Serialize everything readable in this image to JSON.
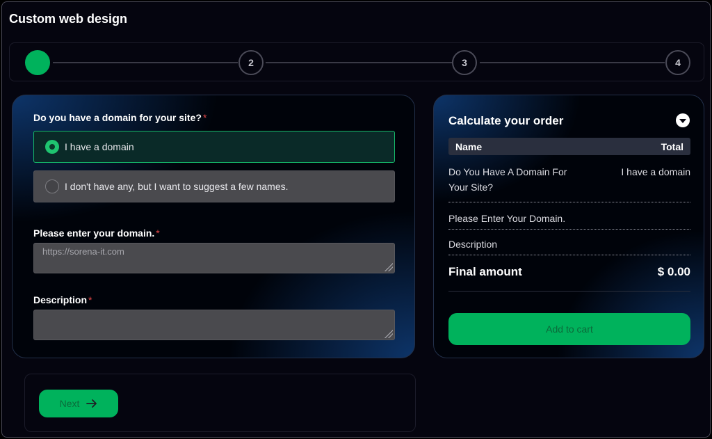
{
  "page": {
    "title": "Custom web design"
  },
  "stepper": {
    "steps": [
      {
        "label": "",
        "active": true
      },
      {
        "label": "2",
        "active": false
      },
      {
        "label": "3",
        "active": false
      },
      {
        "label": "4",
        "active": false
      }
    ]
  },
  "form": {
    "domain_question": "Do you have a domain for your site?",
    "required_mark": "*",
    "options": [
      {
        "label": "I have a domain",
        "selected": true
      },
      {
        "label": "I don't have any, but I want to suggest a few names.",
        "selected": false
      }
    ],
    "domain_label": "Please enter your domain.",
    "domain_placeholder": "https://sorena-it.com",
    "description_label": "Description",
    "description_value": ""
  },
  "navigation": {
    "next_label": "Next"
  },
  "order": {
    "title": "Calculate your order",
    "header_name": "Name",
    "header_total": "Total",
    "rows": [
      {
        "name": "Do You Have A Domain For Your Site?",
        "value": "I have a domain"
      },
      {
        "name": "Please Enter Your Domain.",
        "value": ""
      },
      {
        "name": "Description",
        "value": ""
      }
    ],
    "final_label": "Final amount",
    "final_value": "$ 0.00",
    "add_to_cart_label": "Add to cart"
  },
  "colors": {
    "accent": "#00b25c",
    "required": "#e54848",
    "background": "#05050f"
  }
}
